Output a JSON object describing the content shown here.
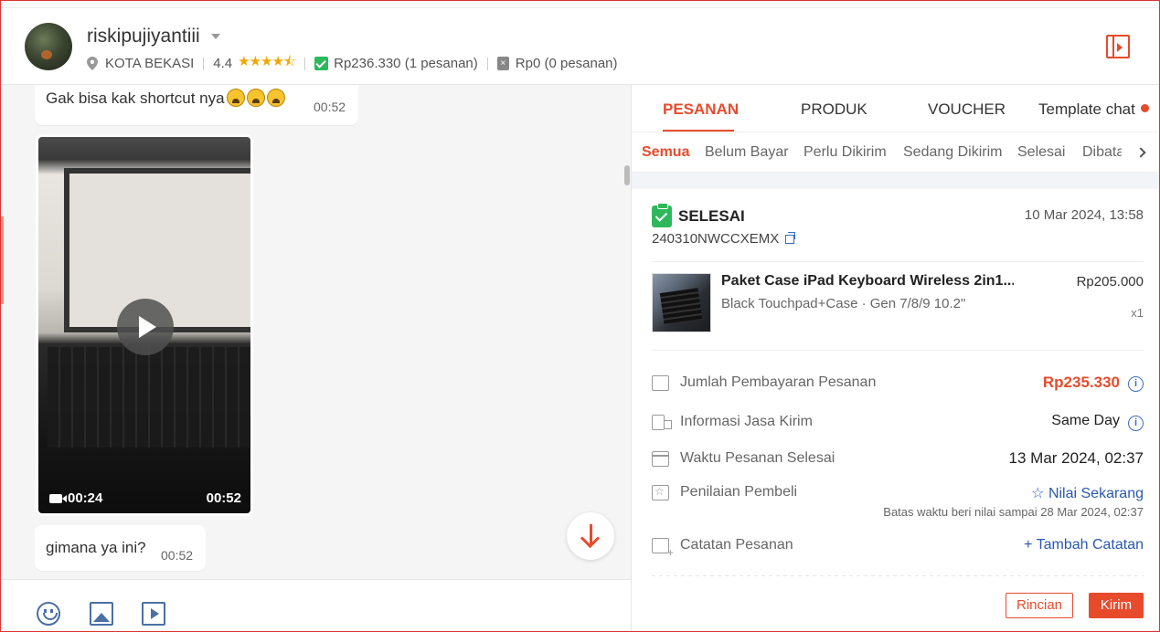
{
  "header": {
    "username": "riskipujiyantiii",
    "location": "KOTA BEKASI",
    "rating": "4.4",
    "rating_value": 4.4,
    "stars": "★★★★⯪",
    "completed_amount": "Rp236.330",
    "completed_orders": "(1 pesanan)",
    "cancelled_amount": "Rp0",
    "cancelled_orders": "(0 pesanan)",
    "accent_color": "#e84b2c"
  },
  "chat": {
    "messages": [
      {
        "text": "Gak bisa kak shortcut nya",
        "emoji_count": 3,
        "time": "00:52"
      },
      {
        "type": "video",
        "duration": "00:24",
        "time": "00:52"
      },
      {
        "text": "gimana ya ini?",
        "time": "00:52"
      }
    ]
  },
  "composer": {
    "icons": [
      "emoji-icon",
      "image-icon",
      "video-icon"
    ]
  },
  "panel": {
    "tabs": [
      "PESANAN",
      "PRODUK",
      "VOUCHER",
      "Template chat"
    ],
    "active_tab": "PESANAN",
    "subtabs": [
      "Semua",
      "Belum Bayar",
      "Perlu Dikirim",
      "Sedang Dikirim",
      "Selesai",
      "Dibata"
    ],
    "active_subtab": "Semua",
    "order": {
      "status": "SELESAI",
      "date": "10 Mar 2024, 13:58",
      "id": "240310NWCCXEMX",
      "product": {
        "name": "Paket Case iPad Keyboard Wireless 2in1...",
        "variant": "Black Touchpad+Case · Gen 7/8/9 10.2\"",
        "price": "Rp205.000",
        "qty": "x1"
      },
      "rows": {
        "payment_label": "Jumlah Pembayaran Pesanan",
        "payment_value": "Rp235.330",
        "shipping_label": "Informasi Jasa Kirim",
        "shipping_value": "Same Day",
        "completed_label": "Waktu Pesanan Selesai",
        "completed_value": "13 Mar 2024, 02:37",
        "rating_label": "Penilaian Pembeli",
        "rating_link": "☆ Nilai Sekarang",
        "rating_note": "Batas waktu beri nilai sampai 28 Mar 2024, 02:37",
        "notes_label": "Catatan Pesanan",
        "notes_link": "+ Tambah Catatan"
      }
    },
    "buttons": {
      "details": "Rincian",
      "send": "Kirim"
    }
  }
}
